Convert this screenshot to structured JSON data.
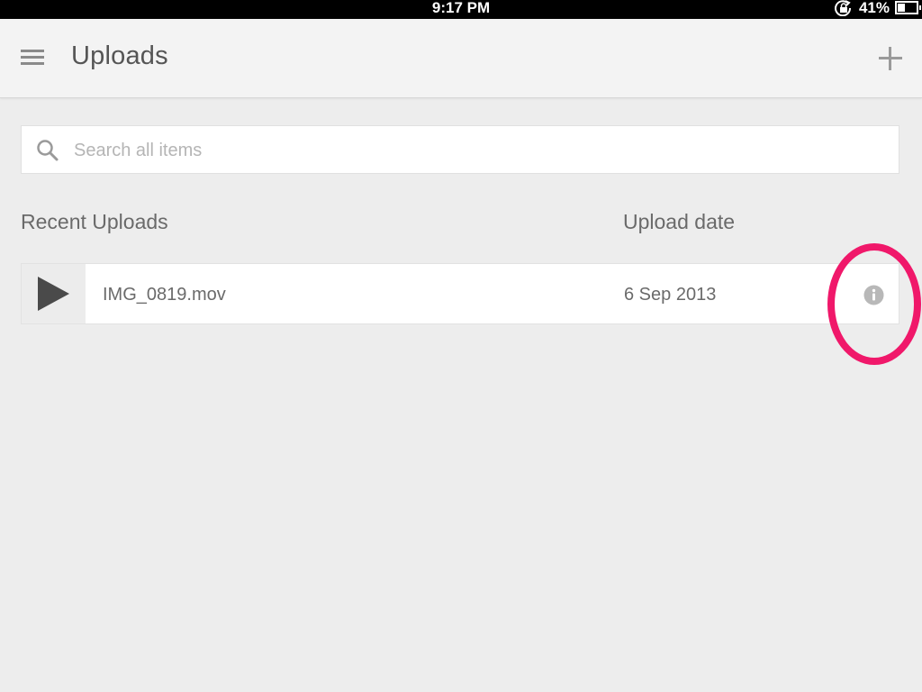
{
  "status_bar": {
    "time": "9:17 PM",
    "battery_percent": "41%",
    "battery_level": 0.41
  },
  "header": {
    "title": "Uploads",
    "menu_icon": "hamburger-menu-icon",
    "add_icon": "plus-icon"
  },
  "search": {
    "placeholder": "Search all items",
    "value": ""
  },
  "columns": {
    "recent": "Recent Uploads",
    "date": "Upload date"
  },
  "uploads": [
    {
      "name": "IMG_0819.mov",
      "date": "6 Sep 2013",
      "thumbnail_icon": "play-icon",
      "action_icon": "info-icon"
    }
  ],
  "colors": {
    "highlight_ring": "#f0186a",
    "background": "#ededed",
    "status_bar": "#000000"
  }
}
